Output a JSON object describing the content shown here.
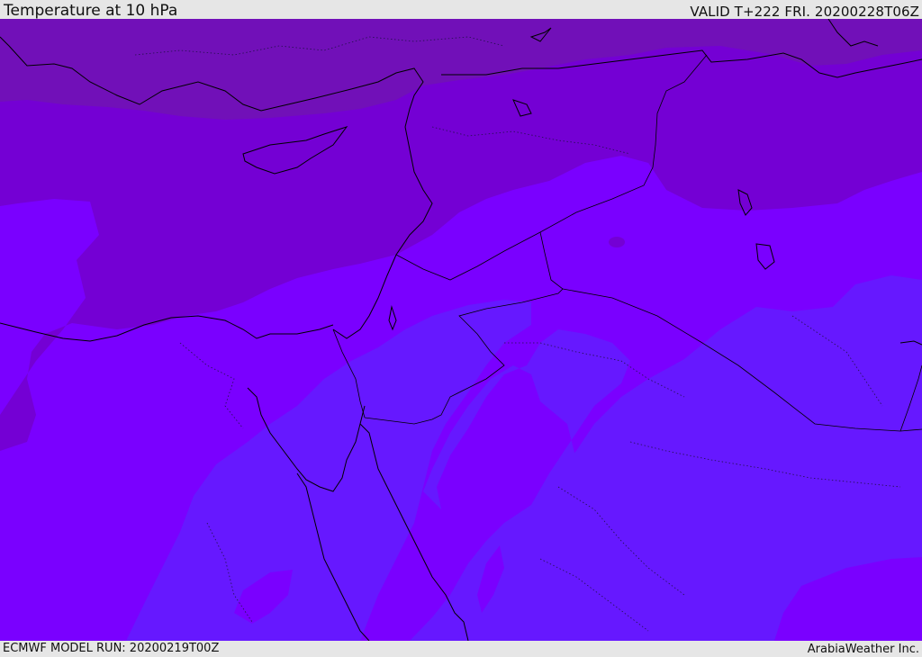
{
  "header": {
    "title": "Temperature at 10 hPa",
    "valid": "VALID T+222 FRI. 20200228T06Z"
  },
  "footer": {
    "model_run": "ECMWF MODEL RUN: 20200219T00Z",
    "credit": "ArabiaWeather Inc."
  },
  "map": {
    "field": "Temperature at 10 hPa",
    "colors": {
      "ocean_warm": "#7a00ff",
      "band_mid": "#7400d4",
      "band_north": "#7110b8",
      "band_cool": "#6618ff",
      "coast": "#000000"
    }
  }
}
